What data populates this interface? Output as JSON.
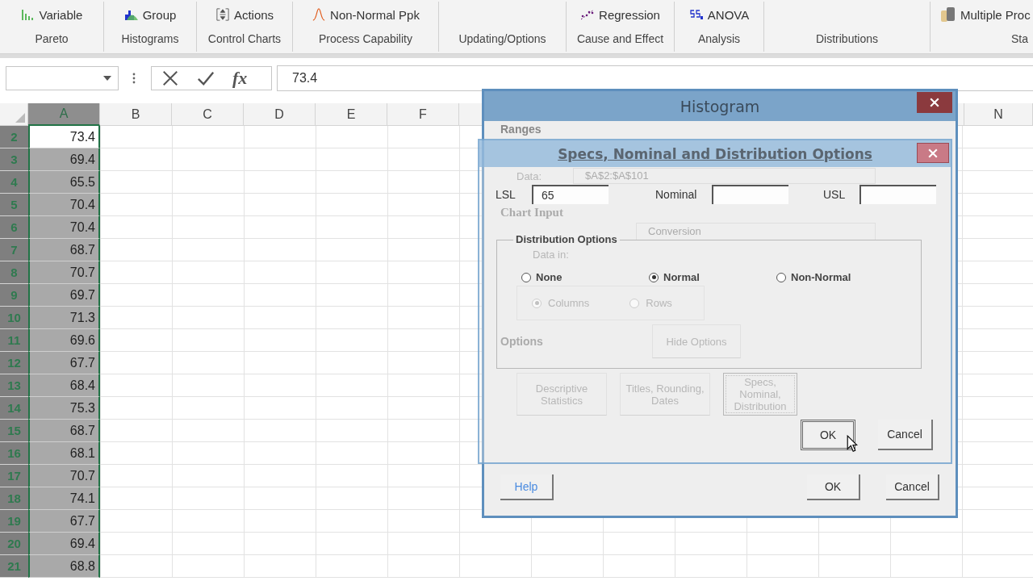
{
  "ribbon": {
    "groups": [
      {
        "label": "Pareto",
        "button": {
          "label": "Variable",
          "kind": "bars"
        }
      },
      {
        "label": "Histograms",
        "button": {
          "label": "Group",
          "kind": "histogram"
        }
      },
      {
        "label": "Control Charts",
        "button": {
          "label": "Actions",
          "kind": "updown"
        }
      },
      {
        "label": "Process Capability",
        "button": {
          "label": "Non-Normal Ppk",
          "kind": "curve"
        }
      },
      {
        "label": "Updating/Options"
      },
      {
        "label": "Cause and Effect",
        "button": {
          "label": "Regression",
          "kind": "scatter"
        }
      },
      {
        "label": "Analysis",
        "button": {
          "label": "ANOVA",
          "kind": "squares"
        }
      },
      {
        "label": "Distributions"
      },
      {
        "label": "Sta",
        "button": {
          "label": "Multiple Proc",
          "kind": "cylinders"
        }
      }
    ]
  },
  "formula_bar": {
    "function_label": "fx",
    "value": "73.4"
  },
  "sheet": {
    "columns": [
      {
        "label": "A",
        "selected": true
      },
      {
        "label": "B",
        "selected": false
      },
      {
        "label": "C",
        "selected": false
      },
      {
        "label": "D",
        "selected": false
      },
      {
        "label": "E",
        "selected": false
      },
      {
        "label": "F",
        "selected": false
      }
    ],
    "right_column": {
      "label": "N",
      "selected": false
    },
    "rows": [
      {
        "number": "2",
        "value": "73.4",
        "active": true,
        "selected": true
      },
      {
        "number": "3",
        "value": "69.4",
        "active": false,
        "selected": true
      },
      {
        "number": "4",
        "value": "65.5",
        "active": false,
        "selected": true
      },
      {
        "number": "5",
        "value": "70.4",
        "active": false,
        "selected": true
      },
      {
        "number": "6",
        "value": "70.4",
        "active": false,
        "selected": true
      },
      {
        "number": "7",
        "value": "68.7",
        "active": false,
        "selected": true
      },
      {
        "number": "8",
        "value": "70.7",
        "active": false,
        "selected": true
      },
      {
        "number": "9",
        "value": "69.7",
        "active": false,
        "selected": true
      },
      {
        "number": "10",
        "value": "71.3",
        "active": false,
        "selected": true
      },
      {
        "number": "11",
        "value": "69.6",
        "active": false,
        "selected": true
      },
      {
        "number": "12",
        "value": "67.7",
        "active": false,
        "selected": true
      },
      {
        "number": "13",
        "value": "68.4",
        "active": false,
        "selected": true
      },
      {
        "number": "14",
        "value": "75.3",
        "active": false,
        "selected": true
      },
      {
        "number": "15",
        "value": "68.7",
        "active": false,
        "selected": true
      },
      {
        "number": "16",
        "value": "68.1",
        "active": false,
        "selected": true
      },
      {
        "number": "17",
        "value": "70.7",
        "active": false,
        "selected": true
      },
      {
        "number": "18",
        "value": "74.1",
        "active": false,
        "selected": true
      },
      {
        "number": "19",
        "value": "67.7",
        "active": false,
        "selected": true
      },
      {
        "number": "20",
        "value": "69.4",
        "active": false,
        "selected": true
      },
      {
        "number": "21",
        "value": "68.8",
        "active": false,
        "selected": true
      }
    ]
  },
  "histogram_dialog": {
    "title": "Histogram",
    "ranges_label": "Ranges",
    "data_label": "Data:",
    "data_value": "$A$2:$A$101",
    "chart_input_label": "Chart Input",
    "conversion_value": "Conversion",
    "data_in_label": "Data in:",
    "data_in_options": [
      {
        "label": "Columns",
        "selected": true
      },
      {
        "label": "Rows",
        "selected": false
      }
    ],
    "options_label": "Options",
    "hide_options_button": "Hide Options",
    "option_buttons": [
      {
        "label": "Descriptive Statistics",
        "focused": false
      },
      {
        "label": "Titles, Rounding, Dates",
        "focused": false
      },
      {
        "label": "Specs, Nominal, Distribution",
        "focused": true
      }
    ],
    "help_button": "Help",
    "ok_button": "OK",
    "cancel_button": "Cancel"
  },
  "specs_dialog": {
    "title": "Specs, Nominal and Distribution Options",
    "lsl": {
      "label": "LSL",
      "value": "65"
    },
    "nominal": {
      "label": "Nominal"
    },
    "usl": {
      "label": "USL"
    },
    "distribution_group": "Distribution Options",
    "distribution_options": [
      {
        "label": "None",
        "selected": false
      },
      {
        "label": "Normal",
        "selected": true
      },
      {
        "label": "Non-Normal",
        "selected": false
      }
    ],
    "ok_button": "OK",
    "cancel_button": "Cancel"
  }
}
